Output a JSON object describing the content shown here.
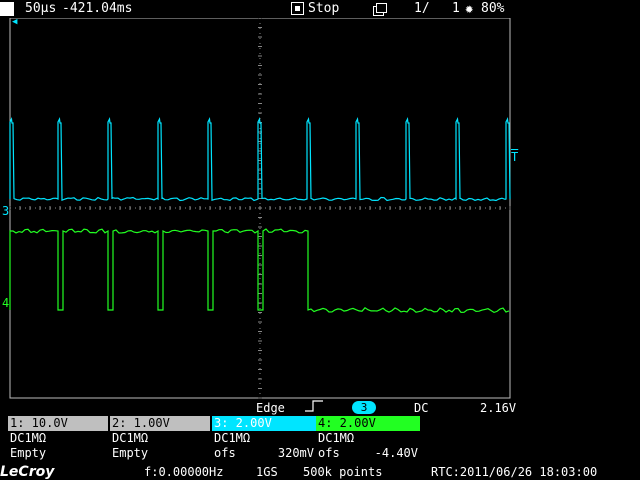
{
  "topbar": {
    "timebase": "50µs",
    "trigger_delay": "-421.04ms",
    "run_state": "Stop",
    "sequence": "1/",
    "sequence_total": "1",
    "battery": "80%",
    "icons": [
      "stop-icon",
      "sequence-icon",
      "brightness-icon"
    ]
  },
  "trigger": {
    "type": "Edge",
    "source": "3",
    "coupling": "DC",
    "level": "2.16V"
  },
  "channels": [
    {
      "header": "1: 10.0V",
      "coupling": "DC1MΩ",
      "status": "Empty",
      "color": "#bfbfbf"
    },
    {
      "header": "2: 1.00V",
      "coupling": "DC1MΩ",
      "status": "Empty",
      "color": "#bfbfbf"
    },
    {
      "header": "3: 2.00V",
      "coupling": "DC1MΩ",
      "offset_label": "ofs",
      "offset": "320mV",
      "color": "#00e5ff"
    },
    {
      "header": "4: 2.00V",
      "coupling": "DC1MΩ",
      "offset_label": "ofs",
      "offset": "-4.40V",
      "color": "#22ff22"
    }
  ],
  "markers": {
    "ch3": "3",
    "ch4": "4",
    "trigger_level": "T"
  },
  "status": {
    "brand": "LeCroy",
    "frequency": "f:0.00000Hz",
    "sample_rate": "1GS",
    "points": "500k points",
    "rtc": "RTC:2011/06/26 18:03:00"
  }
}
